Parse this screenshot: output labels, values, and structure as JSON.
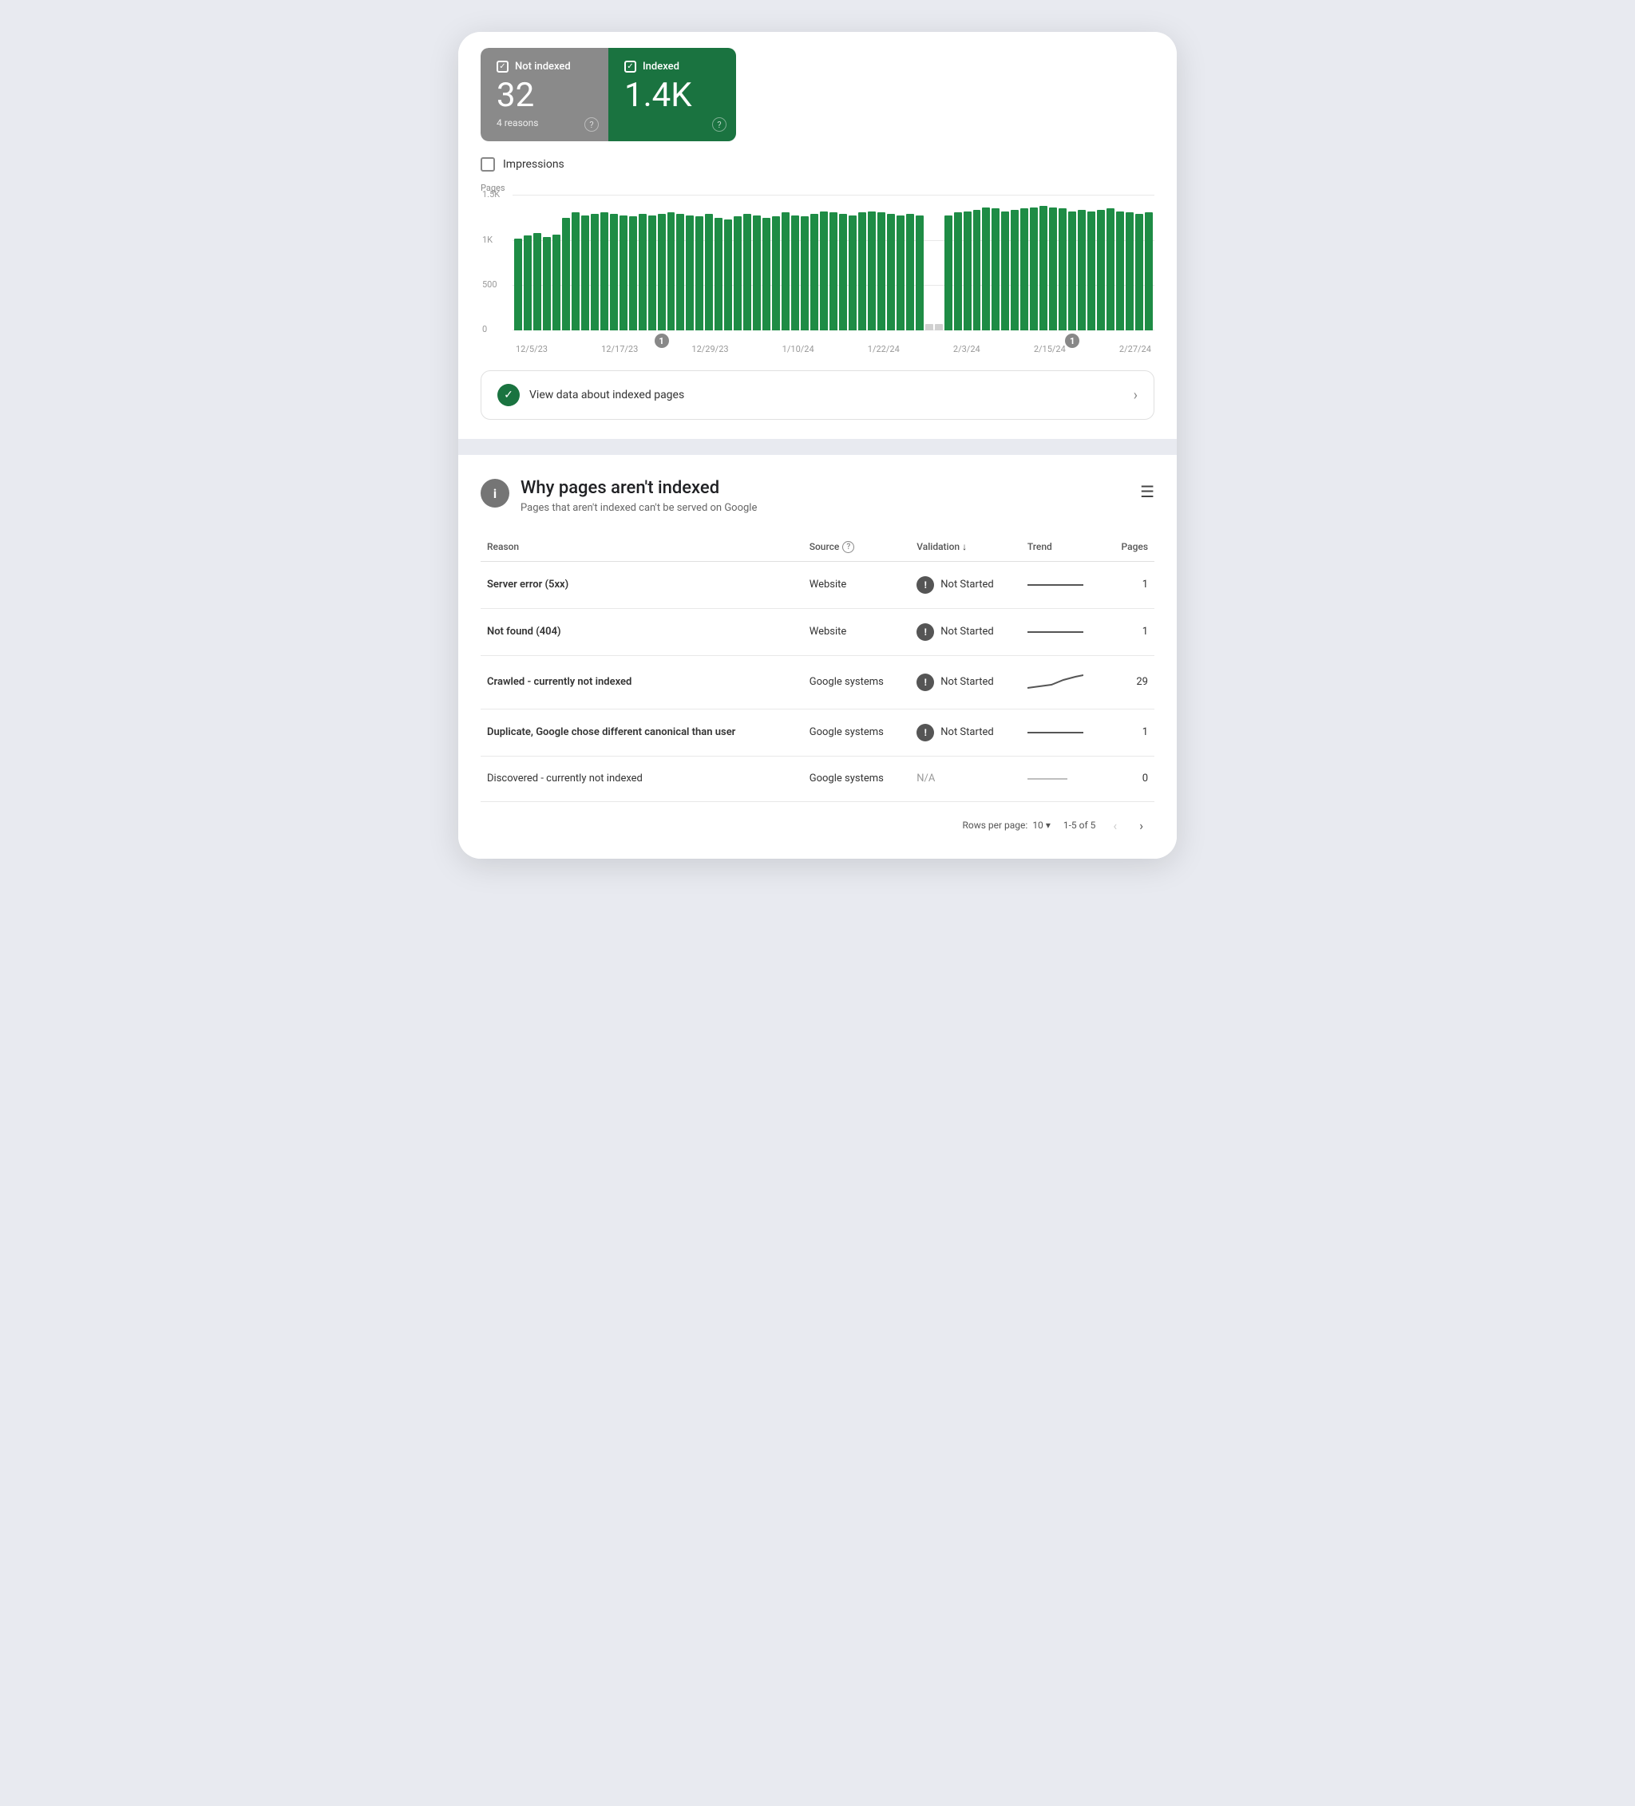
{
  "tabs": {
    "not_indexed": {
      "label": "Not indexed",
      "count": "32",
      "sub": "4 reasons"
    },
    "indexed": {
      "label": "Indexed",
      "count": "1.4K"
    }
  },
  "impressions": {
    "label": "Impressions"
  },
  "chart": {
    "y_label": "Pages",
    "y_max": "1.5K",
    "y_mid_high": "1K",
    "y_mid": "500",
    "y_zero": "0",
    "x_labels": [
      "12/5/23",
      "12/17/23",
      "12/29/23",
      "1/10/24",
      "1/22/24",
      "2/3/24",
      "2/15/24",
      "2/27/24"
    ]
  },
  "view_data": {
    "text": "View data about indexed pages"
  },
  "why_not_indexed": {
    "title": "Why pages aren't indexed",
    "subtitle": "Pages that aren't indexed can't be served on Google"
  },
  "table": {
    "columns": {
      "reason": "Reason",
      "source": "Source",
      "validation": "Validation",
      "trend": "Trend",
      "pages": "Pages"
    },
    "rows": [
      {
        "reason": "Server error (5xx)",
        "bold": true,
        "source": "Website",
        "validation": "Not Started",
        "has_icon": true,
        "trend": "flat",
        "pages": "1"
      },
      {
        "reason": "Not found (404)",
        "bold": true,
        "source": "Website",
        "validation": "Not Started",
        "has_icon": true,
        "trend": "flat",
        "pages": "1"
      },
      {
        "reason": "Crawled - currently not indexed",
        "bold": true,
        "source": "Google systems",
        "validation": "Not Started",
        "has_icon": true,
        "trend": "up",
        "pages": "29"
      },
      {
        "reason": "Duplicate, Google chose different canonical than user",
        "bold": true,
        "source": "Google systems",
        "validation": "Not Started",
        "has_icon": true,
        "trend": "flat",
        "pages": "1"
      },
      {
        "reason": "Discovered - currently not indexed",
        "bold": false,
        "source": "Google systems",
        "validation": "N/A",
        "has_icon": false,
        "trend": "flat-small",
        "pages": "0"
      }
    ]
  },
  "pagination": {
    "rows_per_page_label": "Rows per page:",
    "rows_per_page_value": "10",
    "page_info": "1-5 of 5"
  }
}
